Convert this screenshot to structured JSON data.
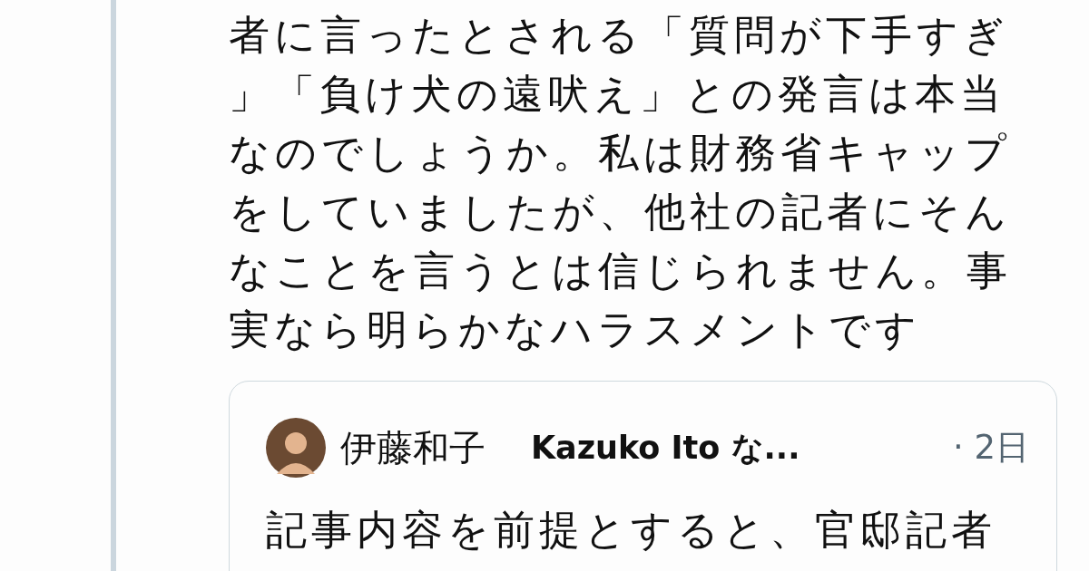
{
  "tweet": {
    "text": "者に言ったとされる「質問が下手すぎ」「負け犬の遠吠え」との発言は本当なのでしょうか。私は財務省キャップをしていましたが、他社の記者にそんなことを言うとは信じられません。事実なら明らかなハラスメントです"
  },
  "quoted_tweet": {
    "display_name": "伊藤和子",
    "handle": "Kazuko Ito な...",
    "time": "· 2日",
    "text": "記事内容を前提とすると、官邸記者"
  }
}
